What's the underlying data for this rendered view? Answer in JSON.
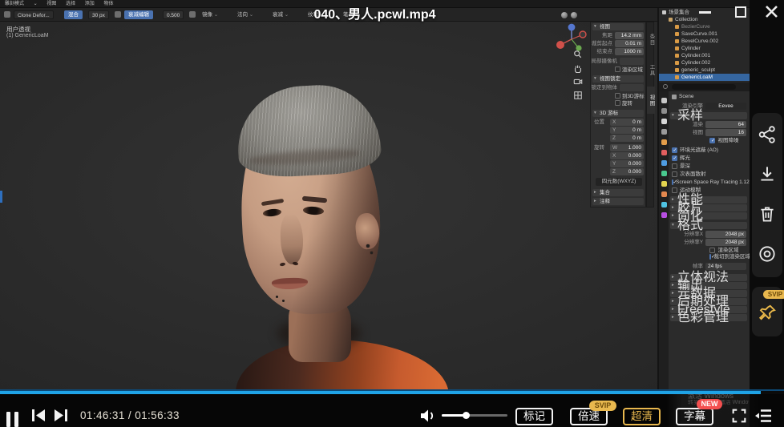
{
  "player": {
    "title": "040、男人.pcwl.mp4",
    "time": "01:46:31 / 01:56:33",
    "progress_played_percent": 97,
    "volume_percent": 36,
    "mark_label": "标记",
    "speed_label": "倍速",
    "quality_label": "超清",
    "subtitle_label": "字幕",
    "speed_badge": "SVIP",
    "subtitle_badge": "NEW",
    "pin_badge": "SVIP",
    "accent_blue": "#1fa3e6",
    "gold": "#e9b84e",
    "badge_red": "#f34f4f",
    "watermark_line1": "激活 Windows",
    "watermark_line2": "转到“设置”以激活 Windows。"
  },
  "blender": {
    "header": {
      "mode": "雕刻模式",
      "menus": [
        "视图",
        "选择",
        "添加",
        "物体"
      ]
    },
    "tools": {
      "brush": "Clone Defor...",
      "chip1": "混合",
      "radius": "30 px",
      "chip2": "衰减编辑",
      "strength": "0.500",
      "dropdowns": [
        "镜像",
        "法向",
        "衰减",
        "纹理",
        "笔画"
      ]
    },
    "viewport": {
      "perspective": "用户透视",
      "object": "(1) GenericLoaM"
    },
    "npanel": {
      "tabs": [
        "条目",
        "工具",
        "视图"
      ],
      "view_title": "视图",
      "view_rows": [
        {
          "label": "焦距",
          "value": "14.2 mm"
        },
        {
          "label": "裁剪起点",
          "value": "0.01 m"
        },
        {
          "label": "结束点",
          "value": "1000 m"
        }
      ],
      "camera_label": "局部摄像机",
      "render_region": "渲染区域",
      "lock_title": "视图锁定",
      "lock_object": "锁定到物体",
      "lock_cursor": "到3D游标",
      "lock_rotation": "旋转",
      "cursor_title": "3D 游标",
      "location_label": "位置",
      "location": [
        {
          "axis": "X",
          "value": "0 m"
        },
        {
          "axis": "Y",
          "value": "0 m"
        },
        {
          "axis": "Z",
          "value": "0 m"
        }
      ],
      "rotation_label": "旋转",
      "rotation": [
        {
          "axis": "W",
          "value": "1.000"
        },
        {
          "axis": "X",
          "value": "0.000"
        },
        {
          "axis": "Y",
          "value": "0.000"
        },
        {
          "axis": "Z",
          "value": "0.000"
        }
      ],
      "rotation_mode": "四元数(WXYZ)",
      "collapsed": [
        "集合",
        "注释"
      ]
    },
    "outliner": {
      "root": "场景集合",
      "items": [
        {
          "name": "Collection"
        },
        {
          "name": "BezierCurve"
        },
        {
          "name": "SaveCurve.001"
        },
        {
          "name": "BevelCurve.002"
        },
        {
          "name": "Cylinder"
        },
        {
          "name": "Cylinder.001"
        },
        {
          "name": "Cylinder.002"
        },
        {
          "name": "generic_sculpt"
        },
        {
          "name": "GenericLoaM"
        }
      ]
    },
    "properties": {
      "breadcrumb": "Scene",
      "engine_label": "渲染引擎",
      "engine_value": "Eevee",
      "sampling_title": "采样",
      "sampling_rows": [
        {
          "label": "渲染",
          "value": "64"
        },
        {
          "label": "视图",
          "value": "16"
        }
      ],
      "denoise": "视图降噪",
      "toggles": [
        {
          "label": "环境光遮蔽 (AO)",
          "checked": true
        },
        {
          "label": "辉光",
          "checked": true
        },
        {
          "label": "景深",
          "checked": false
        },
        {
          "label": "次表面散射",
          "checked": false
        },
        {
          "label": "Screen Space Ray Tracing 1.12",
          "checked": true
        },
        {
          "label": "运动模糊",
          "checked": false
        }
      ],
      "collapsed_mid": [
        "性能",
        "胶片",
        "简化"
      ],
      "format_title": "格式",
      "format_rows": [
        {
          "label": "分辨率X",
          "value": "2048 px"
        },
        {
          "label": "分辨率Y",
          "value": "2048 px"
        }
      ],
      "format_checks": [
        {
          "label": "渲染区域",
          "checked": false
        },
        {
          "label": "裁切到渲染区域",
          "checked": true
        }
      ],
      "framerate_label": "帧率",
      "framerate_value": "24 fps",
      "collapsed_bottom": [
        "立体视法",
        "输出",
        "元数据",
        "后期处理",
        "Freestyle",
        "色彩管理"
      ],
      "tab_colors": [
        "#c8c8c8",
        "#8f8f8f",
        "#d8d8d8",
        "#9a9a9a",
        "#e39d4a",
        "#e35f5f",
        "#4f9de3",
        "#49c98f",
        "#e3d44f",
        "#e3884f",
        "#4fc3e3",
        "#b84fe3"
      ]
    }
  }
}
